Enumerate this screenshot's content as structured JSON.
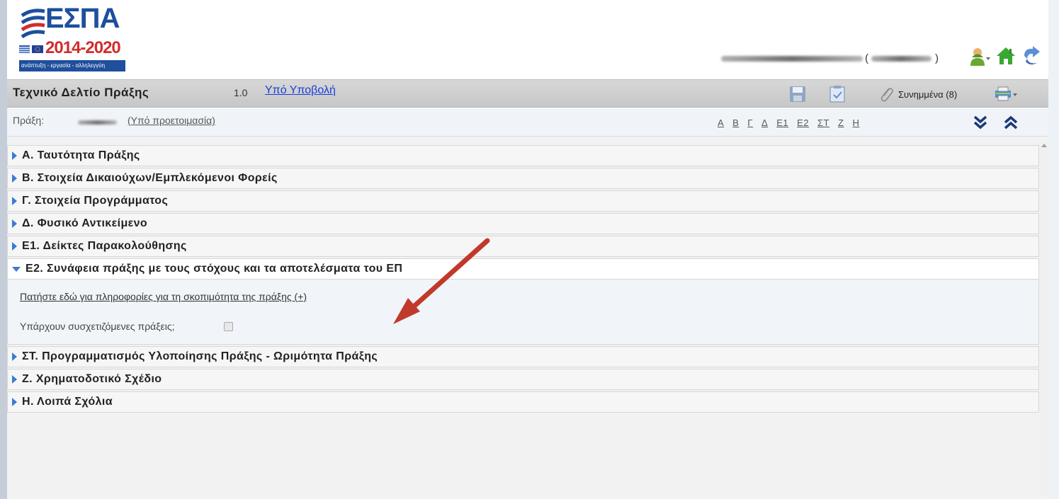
{
  "logo": {
    "word": "ΕΣΠΑ",
    "years": "2014-2020",
    "slogan": "ανάπτυξη - εργασία - αλληλεγγύη"
  },
  "user": {
    "paren_open": "(",
    "paren_close": ")"
  },
  "header_icons": [
    "user-menu-icon",
    "home-icon",
    "logout-icon"
  ],
  "titlebar": {
    "title": "Τεχνικό Δελτίο Πράξης",
    "version": "1.0",
    "status": "Υπό Υποβολή",
    "attachments_label": "Συνημμένα (8)"
  },
  "projectbar": {
    "label": "Πράξη:",
    "status": "(Υπό προετοιμασία)",
    "section_letters": [
      "Α",
      "Β",
      "Γ",
      "Δ",
      "Ε1",
      "Ε2",
      "ΣΤ",
      "Ζ",
      "Η"
    ]
  },
  "sections": [
    {
      "title": "Α. Ταυτότητα Πράξης",
      "expanded": false
    },
    {
      "title": "Β. Στοιχεία Δικαιούχων/Εμπλεκόμενοι Φορείς",
      "expanded": false
    },
    {
      "title": "Γ. Στοιχεία Προγράμματος",
      "expanded": false
    },
    {
      "title": "Δ. Φυσικό Αντικείμενο",
      "expanded": false
    },
    {
      "title": "Ε1. Δείκτες Παρακολούθησης",
      "expanded": false
    },
    {
      "title": "Ε2. Συνάφεια πράξης με τους στόχους και τα αποτελέσματα του ΕΠ",
      "expanded": true
    },
    {
      "title": "ΣΤ. Προγραμματισμός Υλοποίησης Πράξης - Ωριμότητα Πράξης",
      "expanded": false
    },
    {
      "title": "Ζ. Χρηματοδοτικό Σχέδιο",
      "expanded": false
    },
    {
      "title": "Η. Λοιπά Σχόλια",
      "expanded": false
    }
  ],
  "e2_body": {
    "info_link": "Πατήστε εδώ για πληροφορίες για τη σκοπιμότητα της πράξης (+)",
    "related_label": "Υπάρχουν συσχετιζόμενες πράξεις;",
    "related_checked": false
  },
  "colors": {
    "accent": "#3a7bd5",
    "link": "#1a3fd6",
    "annotation_arrow": "#c0392b",
    "logo_blue": "#1d4f9c",
    "logo_red": "#d22d2d"
  }
}
